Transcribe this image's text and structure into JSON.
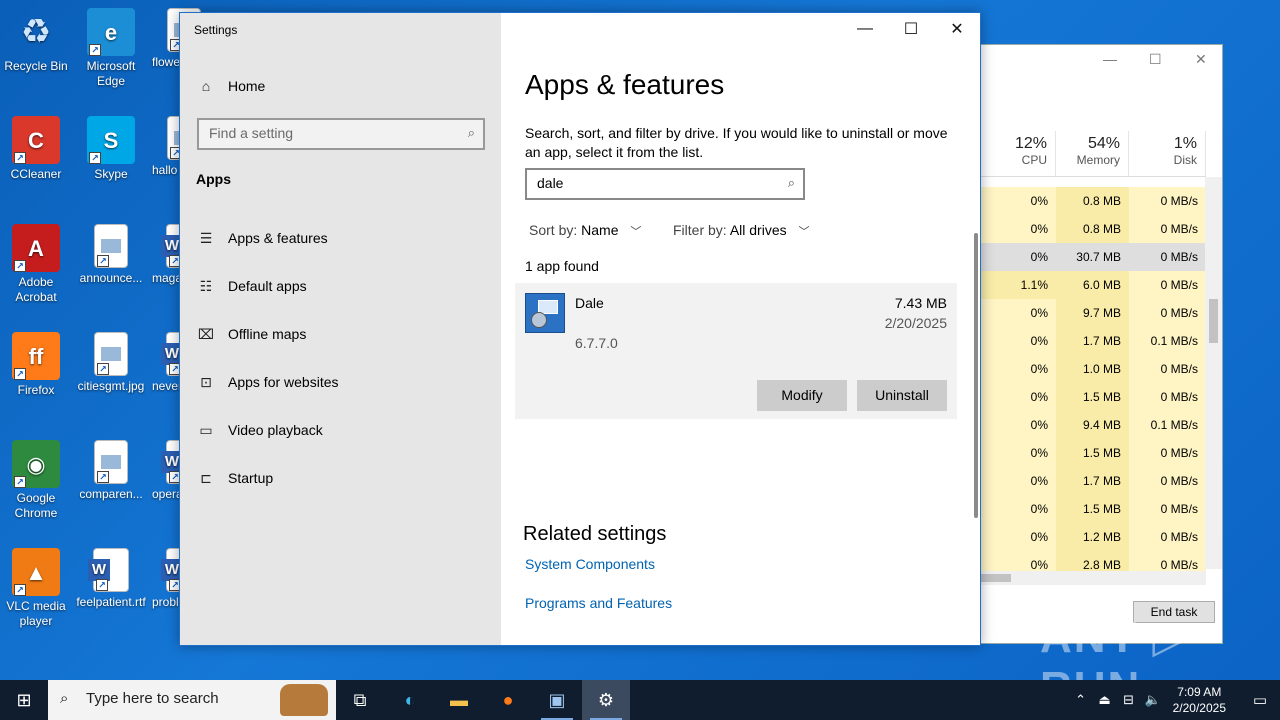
{
  "desktop": {
    "icons": [
      {
        "label": "Recycle Bin",
        "glyph": "♻",
        "color": "#9cc7ef"
      },
      {
        "label": "Microsoft Edge",
        "glyph": "e",
        "color": "#1b8ed6"
      },
      {
        "label": "flowe",
        "glyph": "",
        "color": "#ffffff"
      },
      {
        "label": "CCleaner",
        "glyph": "C",
        "color": "#d9382b"
      },
      {
        "label": "Skype",
        "glyph": "S",
        "color": "#00a7e7"
      },
      {
        "label": "hallo",
        "glyph": "",
        "color": "#ffffff"
      },
      {
        "label": "Adobe Acrobat",
        "glyph": "A",
        "color": "#c51d1d"
      },
      {
        "label": "announce...",
        "glyph": "",
        "color": "#ffffff"
      },
      {
        "label": "maga",
        "glyph": "W",
        "color": "#2b5fb3"
      },
      {
        "label": "Firefox",
        "glyph": "ff",
        "color": "#ff7a18"
      },
      {
        "label": "citiesgmt.jpg",
        "glyph": "",
        "color": "#ffffff"
      },
      {
        "label": "never",
        "glyph": "W",
        "color": "#2b5fb3"
      },
      {
        "label": "Google Chrome",
        "glyph": "◉",
        "color": "#2d8a3f"
      },
      {
        "label": "comparen...",
        "glyph": "",
        "color": "#ffffff"
      },
      {
        "label": "opera",
        "glyph": "W",
        "color": "#2b5fb3"
      },
      {
        "label": "VLC media player",
        "glyph": "▲",
        "color": "#f07a14"
      },
      {
        "label": "feelpatient.rtf",
        "glyph": "W",
        "color": "#2b5fb3"
      },
      {
        "label": "probl",
        "glyph": "W",
        "color": "#2b5fb3"
      }
    ]
  },
  "settings": {
    "window_title": "Settings",
    "controls": {
      "minimize": "—",
      "maximize": "☐",
      "close": "✕"
    },
    "sidebar": {
      "home": "Home",
      "find_placeholder": "Find a setting",
      "section": "Apps",
      "items": [
        {
          "label": "Apps & features",
          "icon": "apps-list-icon",
          "glyph": "☰"
        },
        {
          "label": "Default apps",
          "icon": "default-apps-icon",
          "glyph": "☷"
        },
        {
          "label": "Offline maps",
          "icon": "map-icon",
          "glyph": "⌧"
        },
        {
          "label": "Apps for websites",
          "icon": "web-link-icon",
          "glyph": "⊡"
        },
        {
          "label": "Video playback",
          "icon": "video-icon",
          "glyph": "▭"
        },
        {
          "label": "Startup",
          "icon": "startup-icon",
          "glyph": "⊏"
        }
      ]
    },
    "main": {
      "title": "Apps & features",
      "description": "Search, sort, and filter by drive. If you would like to uninstall or move an app, select it from the list.",
      "search_value": "dale",
      "sort_label": "Sort by:",
      "sort_value": "Name",
      "filter_label": "Filter by:",
      "filter_value": "All drives",
      "found_text": "1 app found",
      "app": {
        "name": "Dale",
        "size": "7.43 MB",
        "date": "2/20/2025",
        "version": "6.7.7.0",
        "modify_label": "Modify",
        "uninstall_label": "Uninstall"
      },
      "related_heading": "Related settings",
      "links": [
        "System Components",
        "Programs and Features"
      ]
    }
  },
  "task_manager": {
    "headers": [
      {
        "pct": "12%",
        "label": "CPU"
      },
      {
        "pct": "54%",
        "label": "Memory"
      },
      {
        "pct": "1%",
        "label": "Disk"
      }
    ],
    "rows": [
      [
        "0%",
        "0.8 MB",
        "0 MB/s"
      ],
      [
        "0%",
        "0.8 MB",
        "0 MB/s"
      ],
      [
        "0%",
        "30.7 MB",
        "0 MB/s"
      ],
      [
        "1.1%",
        "6.0 MB",
        "0 MB/s"
      ],
      [
        "0%",
        "9.7 MB",
        "0 MB/s"
      ],
      [
        "0%",
        "1.7 MB",
        "0.1 MB/s"
      ],
      [
        "0%",
        "1.0 MB",
        "0 MB/s"
      ],
      [
        "0%",
        "1.5 MB",
        "0 MB/s"
      ],
      [
        "0%",
        "9.4 MB",
        "0.1 MB/s"
      ],
      [
        "0%",
        "1.5 MB",
        "0 MB/s"
      ],
      [
        "0%",
        "1.7 MB",
        "0 MB/s"
      ],
      [
        "0%",
        "1.5 MB",
        "0 MB/s"
      ],
      [
        "0%",
        "1.2 MB",
        "0 MB/s"
      ],
      [
        "0%",
        "2.8 MB",
        "0 MB/s"
      ]
    ],
    "end_task": "End task"
  },
  "taskbar": {
    "search_placeholder": "Type here to search",
    "time": "7:09 AM",
    "date": "2/20/2025"
  },
  "watermark": "ANY ▷ RUN"
}
